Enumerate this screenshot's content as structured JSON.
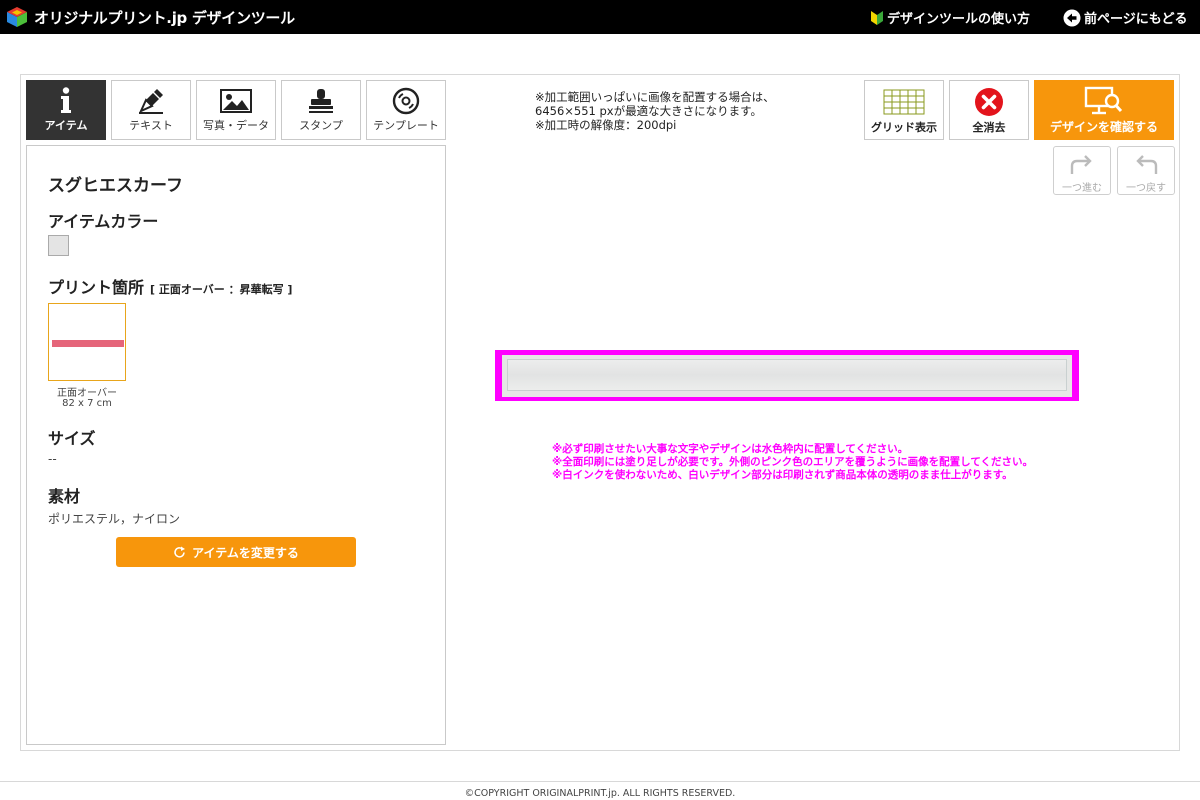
{
  "header": {
    "logo_text": "オリジナルプリント.jp  デザインツール",
    "howto_label": "デザインツールの使い方",
    "back_label": "前ページにもどる"
  },
  "tabs": [
    {
      "label": "アイテム",
      "icon": "info-icon",
      "active": true
    },
    {
      "label": "テキスト",
      "icon": "pen-icon",
      "active": false
    },
    {
      "label": "写真・データ",
      "icon": "image-icon",
      "active": false
    },
    {
      "label": "スタンプ",
      "icon": "stamp-icon",
      "active": false
    },
    {
      "label": "テンプレート",
      "icon": "disc-icon",
      "active": false
    }
  ],
  "item_panel": {
    "product_name": "スグヒエスカーフ",
    "color_title": "アイテムカラー",
    "print_title": "プリント箇所",
    "print_subtitle": "[ 正面オーバー ：昇華転写 ]",
    "print_location_name": "正面オーバー",
    "print_location_size": "82 x 7 cm",
    "size_title": "サイズ",
    "size_value": "--",
    "material_title": "素材",
    "material_value": "ポリエステル，ナイロン",
    "change_button": "アイテムを変更する"
  },
  "notice": {
    "line1": "※加工範囲いっぱいに画像を配置する場合は、",
    "line2": "6456×551 pxが最適な大きさになります。",
    "line3": "※加工時の解像度：200dpi"
  },
  "toolbar": {
    "grid_label": "グリッド表示",
    "clear_label": "全消去",
    "confirm_label": "デザインを確認する",
    "redo_label": "一つ進む",
    "undo_label": "一つ戻す"
  },
  "warnings": [
    "※必ず印刷させたい大事な文字やデザインは水色枠内に配置してください。",
    "※全面印刷には塗り足しが必要です。外側のピンク色のエリアを覆うように画像を配置してください。",
    "※白インクを使わないため、白いデザイン部分は印刷されず商品本体の透明のまま仕上がります。"
  ],
  "footer": {
    "copyright": "©COPYRIGHT ORIGINALPRINT.jp. ALL RIGHTS RESERVED."
  },
  "colors": {
    "accent": "#f7960c",
    "bleed": "#ff00ff",
    "clear_red": "#e3141c"
  }
}
